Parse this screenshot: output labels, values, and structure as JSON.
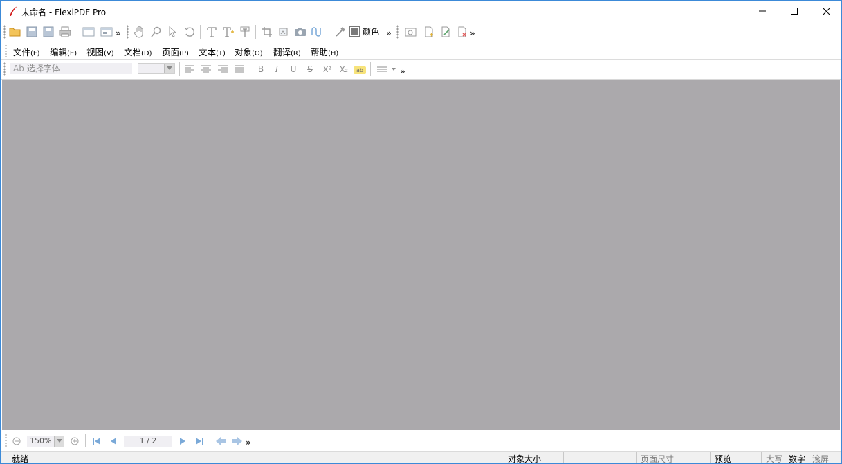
{
  "window": {
    "title": "未命名 - FlexiPDF Pro"
  },
  "toolbar": {
    "color_label": "颜色",
    "overflow": "»"
  },
  "menu": [
    {
      "label": "文件",
      "key": "(F)"
    },
    {
      "label": "编辑",
      "key": "(E)"
    },
    {
      "label": "视图",
      "key": "(V)"
    },
    {
      "label": "文档",
      "key": "(D)"
    },
    {
      "label": "页面",
      "key": "(P)"
    },
    {
      "label": "文本",
      "key": "(T)"
    },
    {
      "label": "对象",
      "key": "(O)"
    },
    {
      "label": "翻译",
      "key": "(R)"
    },
    {
      "label": "帮助",
      "key": "(H)"
    }
  ],
  "format": {
    "font_prefix": "Ab",
    "font_placeholder": "选择字体",
    "font_size": "",
    "bold": "B",
    "italic": "I",
    "underline": "U",
    "strike": "S",
    "superscript": "X²",
    "subscript": "X₂",
    "highlight": "ab"
  },
  "nav": {
    "zoom": "150%",
    "page": "1 / 2"
  },
  "status": {
    "ready": "就绪",
    "object_size": "对象大小",
    "page_size": "页面尺寸",
    "preview": "预览",
    "caps": "大写",
    "num": "数字",
    "scroll": "滚屏"
  },
  "colors": {
    "workspace": "#aba9ac",
    "window_border": "#3c8ad8",
    "icon_gray": "#9aa5b1",
    "icon_blue": "#7aa9d8"
  }
}
